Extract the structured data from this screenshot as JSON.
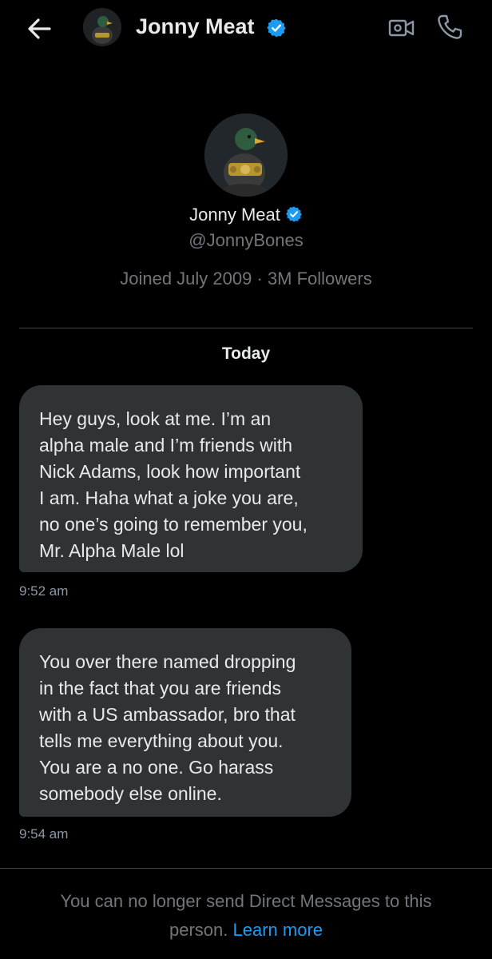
{
  "header": {
    "title": "Jonny Meat",
    "icons": {
      "back": "arrow-left-icon",
      "verified": "verified-badge-icon",
      "video": "video-call-icon",
      "phone": "phone-call-icon"
    }
  },
  "profile": {
    "name": "Jonny Meat",
    "handle": "@JonnyBones",
    "joined": "Joined July 2009",
    "separator": "·",
    "followers": "3M Followers"
  },
  "conversation": {
    "date_label": "Today",
    "messages": [
      {
        "text": "Hey guys, look at me. I’m an\nalpha male and I’m friends with\nNick Adams, look how important\nI am. Haha what a joke you are,\nno one’s going to remember you,\nMr. Alpha Male lol",
        "time": "9:52 am"
      },
      {
        "text": "You over there named dropping\nin the fact that you are friends\nwith a US ambassador, bro that\ntells me everything about you.\nYou are a no one. Go harass\nsomebody else online.",
        "time": "9:54 am"
      }
    ]
  },
  "footer": {
    "notice": "You can no longer send Direct Messages to this person.",
    "learn_more": "Learn more"
  },
  "colors": {
    "background": "#000000",
    "bubble": "#2f3336",
    "accent": "#1d9bf0",
    "muted": "#71767b"
  }
}
